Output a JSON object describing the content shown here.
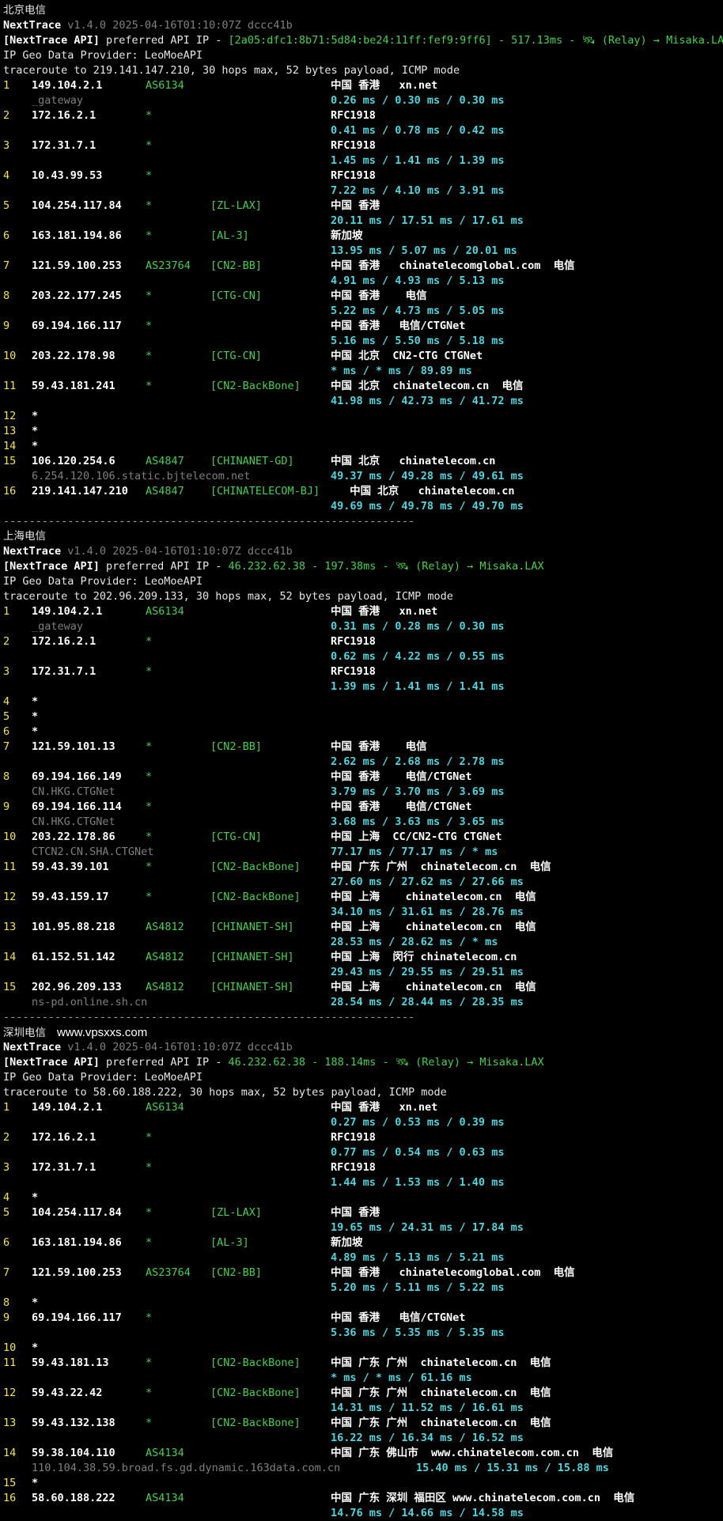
{
  "separator": "----------------------------------------------------------------",
  "sections": [
    {
      "title": "北京电信",
      "watermark": "",
      "tool": "NextTrace",
      "version": "v1.4.0 2025-04-16T01:10:07Z dccc41b",
      "api_prefix": "[NextTrace API]",
      "api_mid": " preferred API IP - ",
      "api_ip": "[2a05:dfc1:8b71:5d84:be24:11ff:fef9:9ff6]",
      "api_tail": " - 517.13ms - 🛰 (Relay) → Misaka.LAX",
      "geo_provider": "IP Geo Data Provider: LeoMoeAPI",
      "trace_line": "traceroute to 219.141.147.210, 30 hops max, 52 bytes payload, ICMP mode",
      "hops": [
        {
          "hop": "1",
          "ip": "149.104.2.1",
          "as": "AS6134",
          "tag": "",
          "geo": "中国 香港   xn.net",
          "extra": "_gateway",
          "rtt": "0.26 ms / 0.30 ms / 0.30 ms"
        },
        {
          "hop": "2",
          "ip": "172.16.2.1",
          "as": "*",
          "tag": "",
          "geo": "RFC1918",
          "extra": "",
          "rtt": "0.41 ms / 0.78 ms / 0.42 ms"
        },
        {
          "hop": "3",
          "ip": "172.31.7.1",
          "as": "*",
          "tag": "",
          "geo": "RFC1918",
          "extra": "",
          "rtt": "1.45 ms / 1.41 ms / 1.39 ms"
        },
        {
          "hop": "4",
          "ip": "10.43.99.53",
          "as": "*",
          "tag": "",
          "geo": "RFC1918",
          "extra": "",
          "rtt": "7.22 ms / 4.10 ms / 3.91 ms"
        },
        {
          "hop": "5",
          "ip": "104.254.117.84",
          "as": "*",
          "tag": "[ZL-LAX]",
          "geo": "中国 香港",
          "extra": "",
          "rtt": "20.11 ms / 17.51 ms / 17.61 ms"
        },
        {
          "hop": "6",
          "ip": "163.181.194.86",
          "as": "*",
          "tag": "[AL-3]",
          "geo": "新加坡",
          "extra": "",
          "rtt": "13.95 ms / 5.07 ms / 20.01 ms"
        },
        {
          "hop": "7",
          "ip": "121.59.100.253",
          "as": "AS23764",
          "tag": "[CN2-BB]",
          "geo": "中国 香港   chinatelecomglobal.com  电信",
          "extra": "",
          "rtt": "4.91 ms / 4.93 ms / 5.13 ms"
        },
        {
          "hop": "8",
          "ip": "203.22.177.245",
          "as": "*",
          "tag": "[CTG-CN]",
          "geo": "中国 香港    电信",
          "extra": "",
          "rtt": "5.22 ms / 4.73 ms / 5.05 ms"
        },
        {
          "hop": "9",
          "ip": "69.194.166.117",
          "as": "*",
          "tag": "",
          "geo": "中国 香港   电信/CTGNet",
          "extra": "",
          "rtt": "5.16 ms / 5.50 ms / 5.18 ms"
        },
        {
          "hop": "10",
          "ip": "203.22.178.98",
          "as": "*",
          "tag": "[CTG-CN]",
          "geo": "中国 北京  CN2-CTG CTGNet",
          "extra": "",
          "rtt": "* ms / * ms / 89.89 ms"
        },
        {
          "hop": "11",
          "ip": "59.43.181.241",
          "as": "*",
          "tag": "[CN2-BackBone]",
          "geo": "中国 北京  chinatelecom.cn  电信",
          "extra": "",
          "rtt": "41.98 ms / 42.73 ms / 41.72 ms"
        },
        {
          "hop": "12",
          "ip": "*",
          "as": "",
          "tag": "",
          "geo": "",
          "extra": "",
          "rtt": ""
        },
        {
          "hop": "13",
          "ip": "*",
          "as": "",
          "tag": "",
          "geo": "",
          "extra": "",
          "rtt": ""
        },
        {
          "hop": "14",
          "ip": "*",
          "as": "",
          "tag": "",
          "geo": "",
          "extra": "",
          "rtt": ""
        },
        {
          "hop": "15",
          "ip": "106.120.254.6",
          "as": "AS4847",
          "tag": "[CHINANET-GD]",
          "geo": "中国 北京   chinatelecom.cn",
          "extra": "6.254.120.106.static.bjtelecom.net",
          "rtt": "49.37 ms / 49.28 ms / 49.61 ms"
        },
        {
          "hop": "16",
          "ip": "219.141.147.210",
          "as": "AS4847",
          "tag": "[CHINATELECOM-BJ]",
          "geo": " 中国 北京   chinatelecom.cn",
          "extra": "",
          "rtt": "49.69 ms / 49.78 ms / 49.70 ms"
        }
      ]
    },
    {
      "title": "上海电信",
      "watermark": "",
      "tool": "NextTrace",
      "version": "v1.4.0 2025-04-16T01:10:07Z dccc41b",
      "api_prefix": "[NextTrace API]",
      "api_mid": " preferred API IP - ",
      "api_ip": "46.232.62.38",
      "api_tail": " - 197.38ms - 🛰 (Relay) → Misaka.LAX",
      "geo_provider": "IP Geo Data Provider: LeoMoeAPI",
      "trace_line": "traceroute to 202.96.209.133, 30 hops max, 52 bytes payload, ICMP mode",
      "hops": [
        {
          "hop": "1",
          "ip": "149.104.2.1",
          "as": "AS6134",
          "tag": "",
          "geo": "中国 香港   xn.net",
          "extra": "_gateway",
          "rtt": "0.31 ms / 0.28 ms / 0.30 ms"
        },
        {
          "hop": "2",
          "ip": "172.16.2.1",
          "as": "*",
          "tag": "",
          "geo": "RFC1918",
          "extra": "",
          "rtt": "0.62 ms / 4.22 ms / 0.55 ms"
        },
        {
          "hop": "3",
          "ip": "172.31.7.1",
          "as": "*",
          "tag": "",
          "geo": "RFC1918",
          "extra": "",
          "rtt": "1.39 ms / 1.41 ms / 1.41 ms"
        },
        {
          "hop": "4",
          "ip": "*",
          "as": "",
          "tag": "",
          "geo": "",
          "extra": "",
          "rtt": ""
        },
        {
          "hop": "5",
          "ip": "*",
          "as": "",
          "tag": "",
          "geo": "",
          "extra": "",
          "rtt": ""
        },
        {
          "hop": "6",
          "ip": "*",
          "as": "",
          "tag": "",
          "geo": "",
          "extra": "",
          "rtt": ""
        },
        {
          "hop": "7",
          "ip": "121.59.101.13",
          "as": "*",
          "tag": "[CN2-BB]",
          "geo": "中国 香港    电信",
          "extra": "",
          "rtt": "2.62 ms / 2.68 ms / 2.78 ms"
        },
        {
          "hop": "8",
          "ip": "69.194.166.149",
          "as": "*",
          "tag": "",
          "geo": "中国 香港    电信/CTGNet",
          "extra": "CN.HKG.CTGNet",
          "rtt": "3.79 ms / 3.70 ms / 3.69 ms"
        },
        {
          "hop": "9",
          "ip": "69.194.166.114",
          "as": "*",
          "tag": "",
          "geo": "中国 香港    电信/CTGNet",
          "extra": "CN.HKG.CTGNet",
          "rtt": "3.68 ms / 3.63 ms / 3.65 ms"
        },
        {
          "hop": "10",
          "ip": "203.22.178.86",
          "as": "*",
          "tag": "[CTG-CN]",
          "geo": "中国 上海  CC/CN2-CTG CTGNet",
          "extra": "CTCN2.CN.SHA.CTGNet",
          "rtt": "77.17 ms / 77.17 ms / * ms"
        },
        {
          "hop": "11",
          "ip": "59.43.39.101",
          "as": "*",
          "tag": "[CN2-BackBone]",
          "geo": "中国 广东 广州  chinatelecom.cn  电信",
          "extra": "",
          "rtt": "27.60 ms / 27.62 ms / 27.66 ms"
        },
        {
          "hop": "12",
          "ip": "59.43.159.17",
          "as": "*",
          "tag": "[CN2-BackBone]",
          "geo": "中国 上海    chinatelecom.cn  电信",
          "extra": "",
          "rtt": "34.10 ms / 31.61 ms / 28.76 ms"
        },
        {
          "hop": "13",
          "ip": "101.95.88.218",
          "as": "AS4812",
          "tag": "[CHINANET-SH]",
          "geo": "中国 上海    chinatelecom.cn  电信",
          "extra": "",
          "rtt": "28.53 ms / 28.62 ms / * ms"
        },
        {
          "hop": "14",
          "ip": "61.152.51.142",
          "as": "AS4812",
          "tag": "[CHINANET-SH]",
          "geo": "中国 上海  闵行 chinatelecom.cn",
          "extra": "",
          "rtt": "29.43 ms / 29.55 ms / 29.51 ms"
        },
        {
          "hop": "15",
          "ip": "202.96.209.133",
          "as": "AS4812",
          "tag": "[CHINANET-SH]",
          "geo": "中国 上海    chinatelecom.cn  电信",
          "extra": "ns-pd.online.sh.cn",
          "rtt": "28.54 ms / 28.44 ms / 28.35 ms"
        }
      ]
    },
    {
      "title": "深圳电信",
      "watermark": "www.vpsxxs.com",
      "tool": "NextTrace",
      "version": "v1.4.0 2025-04-16T01:10:07Z dccc41b",
      "api_prefix": "[NextTrace API]",
      "api_mid": " preferred API IP - ",
      "api_ip": "46.232.62.38",
      "api_tail": " - 188.14ms - 🛰 (Relay) → Misaka.LAX",
      "geo_provider": "IP Geo Data Provider: LeoMoeAPI",
      "trace_line": "traceroute to 58.60.188.222, 30 hops max, 52 bytes payload, ICMP mode",
      "hops": [
        {
          "hop": "1",
          "ip": "149.104.2.1",
          "as": "AS6134",
          "tag": "",
          "geo": "中国 香港   xn.net",
          "extra": "",
          "rtt": "0.27 ms / 0.53 ms / 0.39 ms"
        },
        {
          "hop": "2",
          "ip": "172.16.2.1",
          "as": "*",
          "tag": "",
          "geo": "RFC1918",
          "extra": "",
          "rtt": "0.77 ms / 0.54 ms / 0.63 ms"
        },
        {
          "hop": "3",
          "ip": "172.31.7.1",
          "as": "*",
          "tag": "",
          "geo": "RFC1918",
          "extra": "",
          "rtt": "1.44 ms / 1.53 ms / 1.40 ms"
        },
        {
          "hop": "4",
          "ip": "*",
          "as": "",
          "tag": "",
          "geo": "",
          "extra": "",
          "rtt": ""
        },
        {
          "hop": "5",
          "ip": "104.254.117.84",
          "as": "*",
          "tag": "[ZL-LAX]",
          "geo": "中国 香港",
          "extra": "",
          "rtt": "19.65 ms / 24.31 ms / 17.84 ms"
        },
        {
          "hop": "6",
          "ip": "163.181.194.86",
          "as": "*",
          "tag": "[AL-3]",
          "geo": "新加坡",
          "extra": "",
          "rtt": "4.89 ms / 5.13 ms / 5.21 ms"
        },
        {
          "hop": "7",
          "ip": "121.59.100.253",
          "as": "AS23764",
          "tag": "[CN2-BB]",
          "geo": "中国 香港   chinatelecomglobal.com  电信",
          "extra": "",
          "rtt": "5.20 ms / 5.11 ms / 5.22 ms"
        },
        {
          "hop": "8",
          "ip": "*",
          "as": "",
          "tag": "",
          "geo": "",
          "extra": "",
          "rtt": ""
        },
        {
          "hop": "9",
          "ip": "69.194.166.117",
          "as": "*",
          "tag": "",
          "geo": "中国 香港   电信/CTGNet",
          "extra": "",
          "rtt": "5.36 ms / 5.35 ms / 5.35 ms"
        },
        {
          "hop": "10",
          "ip": "*",
          "as": "",
          "tag": "",
          "geo": "",
          "extra": "",
          "rtt": ""
        },
        {
          "hop": "11",
          "ip": "59.43.181.13",
          "as": "*",
          "tag": "[CN2-BackBone]",
          "geo": "中国 广东 广州  chinatelecom.cn  电信",
          "extra": "",
          "rtt": "* ms / * ms / 61.16 ms"
        },
        {
          "hop": "12",
          "ip": "59.43.22.42",
          "as": "*",
          "tag": "[CN2-BackBone]",
          "geo": "中国 广东 广州  chinatelecom.cn  电信",
          "extra": "",
          "rtt": "14.31 ms / 11.52 ms / 16.61 ms"
        },
        {
          "hop": "13",
          "ip": "59.43.132.138",
          "as": "*",
          "tag": "[CN2-BackBone]",
          "geo": "中国 广东 广州  chinatelecom.cn  电信",
          "extra": "",
          "rtt": "16.22 ms / 16.34 ms / 16.52 ms"
        },
        {
          "hop": "14",
          "ip": "59.38.104.110",
          "as": "AS4134",
          "tag": "",
          "geo": "中国 广东 佛山市  www.chinatelecom.com.cn  电信",
          "extra": "110.104.38.59.broad.fs.gd.dynamic.163data.com.cn",
          "rtt": "15.40 ms / 15.31 ms / 15.88 ms",
          "rtt_inline": true
        },
        {
          "hop": "15",
          "ip": "*",
          "as": "",
          "tag": "",
          "geo": "",
          "extra": "",
          "rtt": ""
        },
        {
          "hop": "16",
          "ip": "58.60.188.222",
          "as": "AS4134",
          "tag": "",
          "geo": "中国 广东 深圳 福田区 www.chinatelecom.com.cn  电信",
          "extra": "",
          "rtt": "14.76 ms / 14.66 ms / 14.58 ms"
        }
      ]
    }
  ]
}
